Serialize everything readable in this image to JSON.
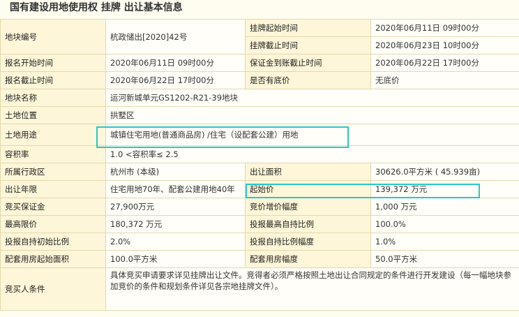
{
  "title": "国有建设用地使用权 挂牌 出让基本信息",
  "rows": {
    "plot_no": {
      "label": "地块编号",
      "value": "杭政储出[2020]42号"
    },
    "listing_start_time": {
      "label": "挂牌起始时间",
      "value": "2020年06月11日 09时00分"
    },
    "listing_end_time": {
      "label": "挂牌截止时间",
      "value": "2020年06月23日 10时00分"
    },
    "signup_start": {
      "label": "报名开始时间",
      "value": "2020年06月11日 09时00分"
    },
    "deposit_deadline": {
      "label": "保证金到账截止时间",
      "value": "2020年06月22日 17时00分"
    },
    "signup_end": {
      "label": "报名截止时间",
      "value": "2020年06月22日 17时00分"
    },
    "reserve_price": {
      "label": "是否有底价",
      "value": "无底价"
    },
    "plot_name": {
      "label": "地块名称",
      "value": "运河新城单元GS1202-R21-39地块"
    },
    "location": {
      "label": "土地位置",
      "value": "拱墅区"
    },
    "land_use": {
      "label": "土地用途",
      "value": "城镇住宅用地(普通商品房) /住宅（设配套公建）用地"
    },
    "plot_ratio": {
      "label": "容积率",
      "value": "1.0 <容积率≤ 2.5"
    },
    "district": {
      "label": "所属行政区",
      "value": "杭州市 (本级)"
    },
    "area": {
      "label": "出让面积",
      "value": "30626.0平方米 ( 45.939亩)"
    },
    "term": {
      "label": "出让年限",
      "value": "住宅用地70年、配套公建用地40年"
    },
    "start_price": {
      "label": "起始价",
      "value": "139,372 万元"
    },
    "bid_deposit": {
      "label": "竞买保证金",
      "value": "27,900万元"
    },
    "increment": {
      "label": "竞价增价幅度",
      "value": "1,000 万元"
    },
    "max_price": {
      "label": "最高限价",
      "value": "180,372 万元"
    },
    "self_holding_max": {
      "label": "投报最高自持比例",
      "value": "100.0%"
    },
    "self_holding_init": {
      "label": "投报自持初始比例",
      "value": "2.0%"
    },
    "self_holding_step": {
      "label": "投报自持比例幅度",
      "value": "1.0%"
    },
    "housing_start_area": {
      "label": "配套用房起始面积",
      "value": "100.0平方米"
    },
    "housing_step": {
      "label": "配套用房幅度",
      "value": "50.0平方米"
    },
    "conditions": {
      "label": "竞买人条件",
      "value": "具体竞买申请要求详见挂牌出让文件。竞得者必须严格按照土地出让合同规定的条件进行开发建设（每一幅地块参加竞价的条件和规划条件详见各宗地挂牌文件）。"
    }
  },
  "colors": {
    "highlight": "#29c7c7",
    "label_bg": "#fdf6d8",
    "value_bg": "#fffef8",
    "border": "#e3d9b0"
  }
}
